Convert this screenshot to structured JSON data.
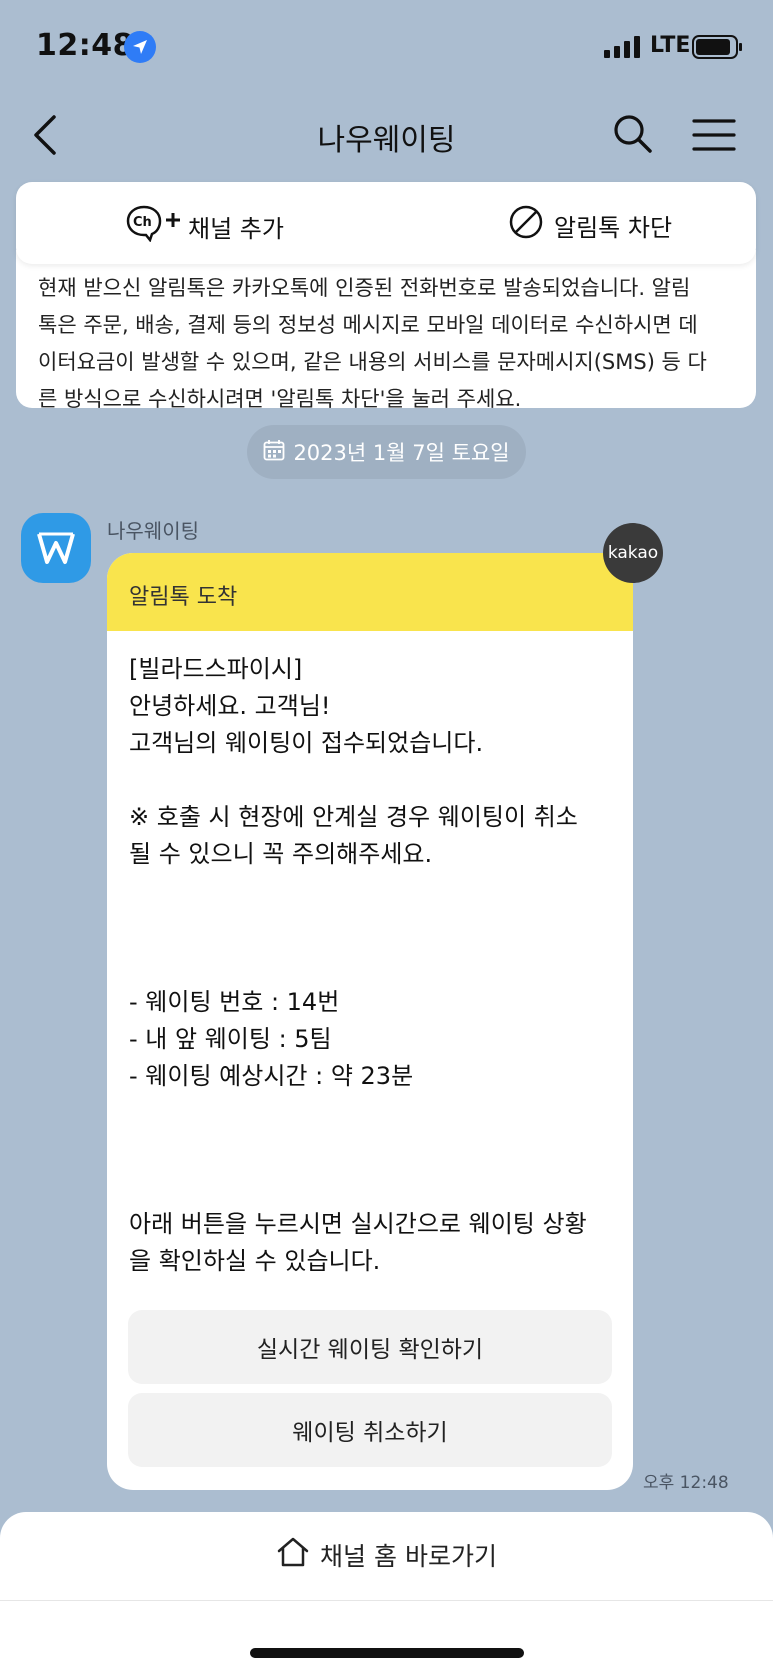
{
  "status_bar": {
    "time": "12:48",
    "network": "LTE"
  },
  "header": {
    "title": "나우웨이팅"
  },
  "channel_bar": {
    "add_label": "채널 추가",
    "block_label": "알림톡 차단"
  },
  "notice": {
    "lines": [
      "현재 받으신 알림톡은 카카오톡에 인증된 전화번호로 발송되었습니다. 알림",
      "톡은 주문, 배송, 결제 등의 정보성 메시지로 모바일 데이터로 수신하시면 데",
      "이터요금이 발생할 수 있으며, 같은 내용의 서비스를 문자메시지(SMS) 등 다",
      "른 방식으로 수신하시려면 '알림톡 차단'을 눌러 주세요."
    ]
  },
  "date_divider": "2023년 1월 7일 토요일",
  "message": {
    "sender": "나우웨이팅",
    "badge": "kakao",
    "header": "알림톡 도착",
    "body_lines": [
      "[빌라드스파이시]",
      "안녕하세요. 고객님!",
      "고객님의 웨이팅이 접수되었습니다.",
      "",
      "※ 호출 시 현장에 안계실 경우 웨이팅이 취소",
      "될 수 있으니 꼭 주의해주세요.",
      "",
      "",
      "",
      "- 웨이팅 번호 : 14번",
      "- 내 앞 웨이팅 : 5팀",
      "- 웨이팅 예상시간 : 약 23분",
      "",
      "",
      "",
      "아래 버튼을 누르시면 실시간으로 웨이팅 상황",
      "을 확인하실 수 있습니다."
    ],
    "buttons": {
      "check": "실시간 웨이팅 확인하기",
      "cancel": "웨이팅 취소하기"
    },
    "time": "오후 12:48"
  },
  "bottom": {
    "home_link": "채널 홈 바로가기"
  },
  "colors": {
    "background": "#abbdd0",
    "bubble_header": "#f9e44d",
    "avatar": "#2f9ae6"
  }
}
